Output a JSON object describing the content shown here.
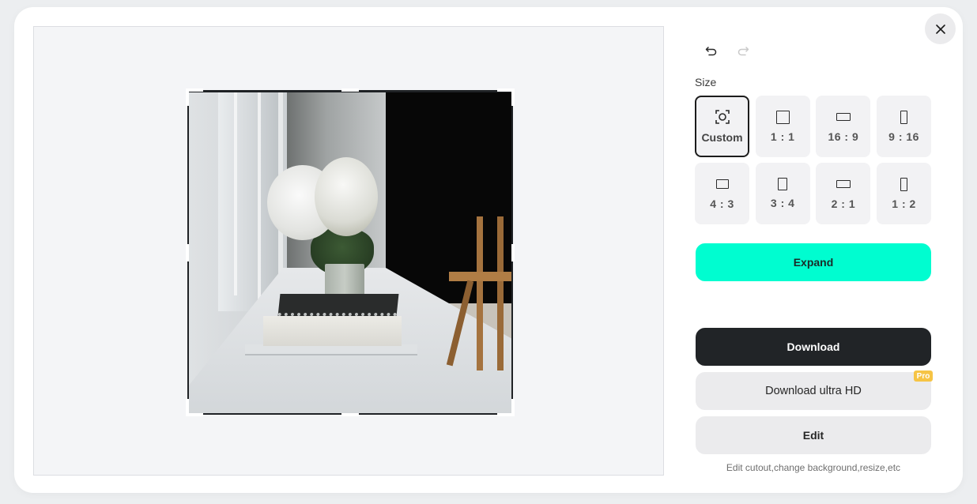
{
  "toolbar": {
    "undo_icon": "undo-icon",
    "redo_icon": "redo-icon",
    "redo_enabled": false,
    "close_icon": "close-icon"
  },
  "size": {
    "label": "Size",
    "selected": "Custom",
    "options": [
      {
        "label": "Custom",
        "icon": "custom-crop-icon"
      },
      {
        "label": "1 : 1",
        "icon": "square-icon"
      },
      {
        "label": "16 : 9",
        "icon": "landscape-wide-icon"
      },
      {
        "label": "9 : 16",
        "icon": "portrait-tall-icon"
      },
      {
        "label": "4 : 3",
        "icon": "landscape-icon"
      },
      {
        "label": "3 : 4",
        "icon": "portrait-icon"
      },
      {
        "label": "2 : 1",
        "icon": "landscape-wide-icon"
      },
      {
        "label": "1 : 2",
        "icon": "portrait-tall-icon"
      }
    ]
  },
  "actions": {
    "expand_label": "Expand",
    "download_label": "Download",
    "download_hd_label": "Download ultra HD",
    "pro_badge": "Pro",
    "edit_label": "Edit",
    "edit_hint": "Edit cutout,change background,resize,etc"
  },
  "colors": {
    "expand": "#00fdd0",
    "download": "#212427",
    "pro_badge": "#f6c445"
  },
  "canvas": {
    "image_description": "Photo of white hydrangeas in a glass vase on a white desk by a window with stacked books and a wooden chair"
  }
}
